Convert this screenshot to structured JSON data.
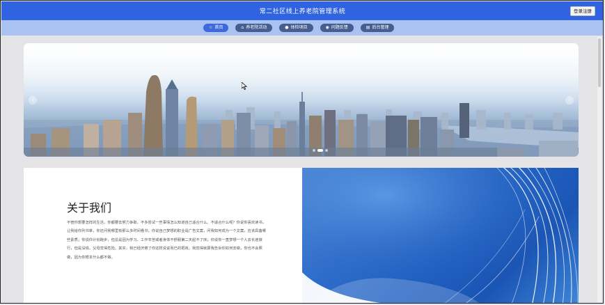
{
  "header": {
    "title": "常二社区线上养老院管理系统",
    "login_label": "登录注册"
  },
  "nav": {
    "items": [
      {
        "label": "首页",
        "icon": "star-icon"
      },
      {
        "label": "养老院活动",
        "icon": "home-icon"
      },
      {
        "label": "体检项目",
        "icon": "info-icon"
      },
      {
        "label": "问题反馈",
        "icon": "chat-icon"
      },
      {
        "label": "后台管理",
        "icon": "admin-icon"
      }
    ]
  },
  "about": {
    "title": "关于我们",
    "body": "不管你想要怎样的生活，你都要去努力争取，不多尝试一些事情怎么知道自己适合什么、不适合什么呢？你说你喜欢读书，让我给你列书单，你还问我哪里有那么多时间看书；你说自己梦想的职业是广告文案，问我如何成为一个文案，应该具备哪些素质；你说你计划跑步，但总是因为学习、工作辛苦或者身体不舒服第二天起不了床；你说你一直梦想一个人去长途旅行，但是没钱，父母觉得危险。其实，我已经厌倦了你这样说说而已的把戏，我觉得就算我告诉你如何去做，你也不会照做，因为你根本什么都不做。"
  },
  "colors": {
    "header_bg": "#2f63e0",
    "nav_bg": "#a9c2f2",
    "nav_item_bg": "#465e8f",
    "nav_item_active": "#3e6ad9"
  }
}
